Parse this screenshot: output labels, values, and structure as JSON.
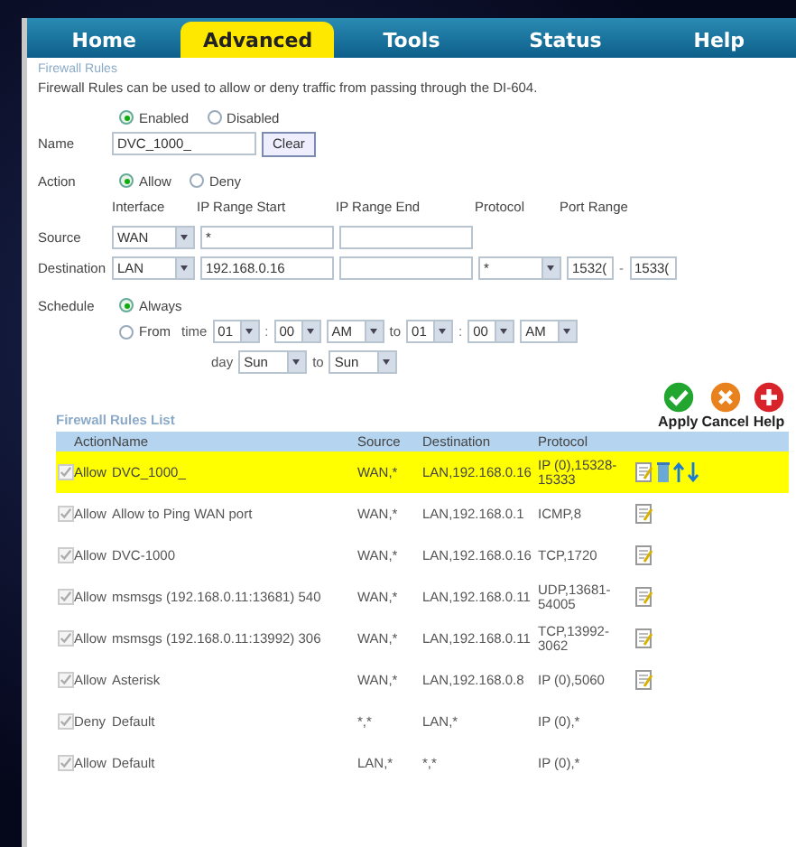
{
  "tabs": [
    {
      "label": "Home",
      "selected": false
    },
    {
      "label": "Advanced",
      "selected": true
    },
    {
      "label": "Tools",
      "selected": false
    },
    {
      "label": "Status",
      "selected": false
    },
    {
      "label": "Help",
      "selected": false
    }
  ],
  "section_title": "Firewall Rules",
  "description": "Firewall Rules can be used to allow or deny traffic from passing through the DI-604.",
  "status_options": [
    {
      "label": "Enabled",
      "selected": true
    },
    {
      "label": "Disabled",
      "selected": false
    }
  ],
  "name": {
    "label": "Name",
    "value": "DVC_1000_",
    "button": "Clear"
  },
  "action": {
    "label": "Action",
    "options": [
      {
        "label": "Allow",
        "selected": true
      },
      {
        "label": "Deny",
        "selected": false
      }
    ]
  },
  "columns": [
    "Interface",
    "IP Range Start",
    "IP Range End",
    "Protocol",
    "Port Range"
  ],
  "source": {
    "label": "Source",
    "interface": "WAN",
    "ip_start": "*"
  },
  "destination": {
    "label": "Destination",
    "interface": "LAN",
    "ip_start": "192.168.0.16",
    "protocol": "*",
    "port_start": "1532(",
    "port_sep": "-",
    "port_end": "1533("
  },
  "schedule": {
    "label": "Schedule",
    "always": {
      "label": "Always",
      "selected": true
    },
    "from": {
      "label": "From",
      "selected": false
    },
    "time_label": "time",
    "start_hour": "01",
    "sep1": ":",
    "start_min": "00",
    "start_ampm": "AM",
    "to1": "to",
    "end_hour": "01",
    "sep2": ":",
    "end_min": "00",
    "end_ampm": "AM",
    "day_label": "day",
    "start_day": "Sun",
    "to2": "to",
    "end_day": "Sun"
  },
  "buttons": [
    {
      "label": "Apply",
      "kind": "apply"
    },
    {
      "label": "Cancel",
      "kind": "cancel"
    },
    {
      "label": "Help",
      "kind": "help"
    }
  ],
  "list": {
    "title": "Firewall Rules List",
    "headers": [
      "Action",
      "Name",
      "Source",
      "Destination",
      "Protocol"
    ],
    "rows": [
      {
        "checked": true,
        "selected": true,
        "action": "Allow",
        "name": "DVC_1000_",
        "source": "WAN,*",
        "destination": "LAN,192.168.0.16",
        "protocol": "IP (0),15328-15333",
        "editable": true
      },
      {
        "checked": true,
        "selected": false,
        "action": "Allow",
        "name": "Allow to Ping WAN port",
        "source": "WAN,*",
        "destination": "LAN,192.168.0.1",
        "protocol": "ICMP,8",
        "editable": true
      },
      {
        "checked": true,
        "selected": false,
        "action": "Allow",
        "name": "DVC-1000",
        "source": "WAN,*",
        "destination": "LAN,192.168.0.16",
        "protocol": "TCP,1720",
        "editable": true
      },
      {
        "checked": true,
        "selected": false,
        "action": "Allow",
        "name": "msmsgs (192.168.0.11:13681) 540",
        "source": "WAN,*",
        "destination": "LAN,192.168.0.11",
        "protocol": "UDP,13681-54005",
        "editable": true
      },
      {
        "checked": true,
        "selected": false,
        "action": "Allow",
        "name": "msmsgs (192.168.0.11:13992) 306",
        "source": "WAN,*",
        "destination": "LAN,192.168.0.11",
        "protocol": "TCP,13992-3062",
        "editable": true
      },
      {
        "checked": true,
        "selected": false,
        "action": "Allow",
        "name": "Asterisk",
        "source": "WAN,*",
        "destination": "LAN,192.168.0.8",
        "protocol": "IP (0),5060",
        "editable": true
      },
      {
        "checked": true,
        "selected": false,
        "action": "Deny",
        "name": "Default",
        "source": "*,*",
        "destination": "LAN,*",
        "protocol": "IP (0),*",
        "editable": false
      },
      {
        "checked": true,
        "selected": false,
        "action": "Allow",
        "name": "Default",
        "source": "LAN,*",
        "destination": "*,*",
        "protocol": "IP (0),*",
        "editable": false
      }
    ]
  }
}
